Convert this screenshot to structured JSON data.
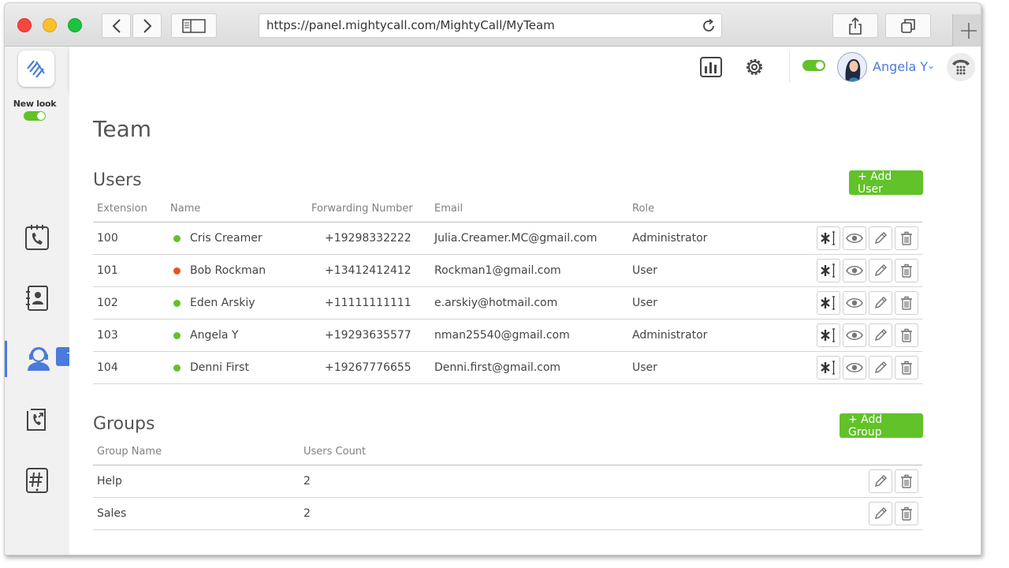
{
  "browser": {
    "url": "https://panel.mightycall.com/MightyCall/MyTeam",
    "icons": [
      "back-icon",
      "forward-icon",
      "sidebar-icon",
      "reload-icon",
      "share-icon",
      "tabs-icon",
      "new-tab-icon"
    ]
  },
  "sidebar": {
    "new_look_label": "New look",
    "tooltip": "Team",
    "items": [
      "phone-icon",
      "contacts-icon",
      "team-icon",
      "callback-icon",
      "number-icon"
    ]
  },
  "topbar": {
    "user_name": "Angela Y",
    "chevron": "⌄",
    "icons": [
      "reports-icon",
      "settings-icon",
      "status-toggle",
      "dialpad-icon"
    ]
  },
  "page": {
    "title": "Team"
  },
  "users": {
    "title": "Users",
    "add_label": "+ Add User",
    "columns": {
      "extension": "Extension",
      "name": "Name",
      "forwarding": "Forwarding Number",
      "email": "Email",
      "role": "Role"
    },
    "rows": [
      {
        "extension": "100",
        "name": "Cris Creamer",
        "status": "#61c229",
        "forwarding": "+19298332222",
        "email": "Julia.Creamer.MC@gmail.com",
        "role": "Administrator"
      },
      {
        "extension": "101",
        "name": "Bob Rockman",
        "status": "#e5532d",
        "forwarding": "+13412412412",
        "email": "Rockman1@gmail.com",
        "role": "User"
      },
      {
        "extension": "102",
        "name": "Eden Arskiy",
        "status": "#61c229",
        "forwarding": "+11111111111",
        "email": "e.arskiy@hotmail.com",
        "role": "User"
      },
      {
        "extension": "103",
        "name": "Angela Y",
        "status": "#61c229",
        "forwarding": "+19293635577",
        "email": "nman25540@gmail.com",
        "role": "Administrator"
      },
      {
        "extension": "104",
        "name": "Denni First",
        "status": "#61c229",
        "forwarding": "+19267776655",
        "email": "Denni.first@gmail.com",
        "role": "User"
      }
    ]
  },
  "groups": {
    "title": "Groups",
    "add_label": "+ Add Group",
    "columns": {
      "name": "Group Name",
      "count": "Users Count"
    },
    "rows": [
      {
        "name": "Help",
        "count": "2"
      },
      {
        "name": "Sales",
        "count": "2"
      }
    ]
  },
  "colors": {
    "accent": "#4a7bdb",
    "green": "#61c229",
    "red": "#e5532d"
  }
}
